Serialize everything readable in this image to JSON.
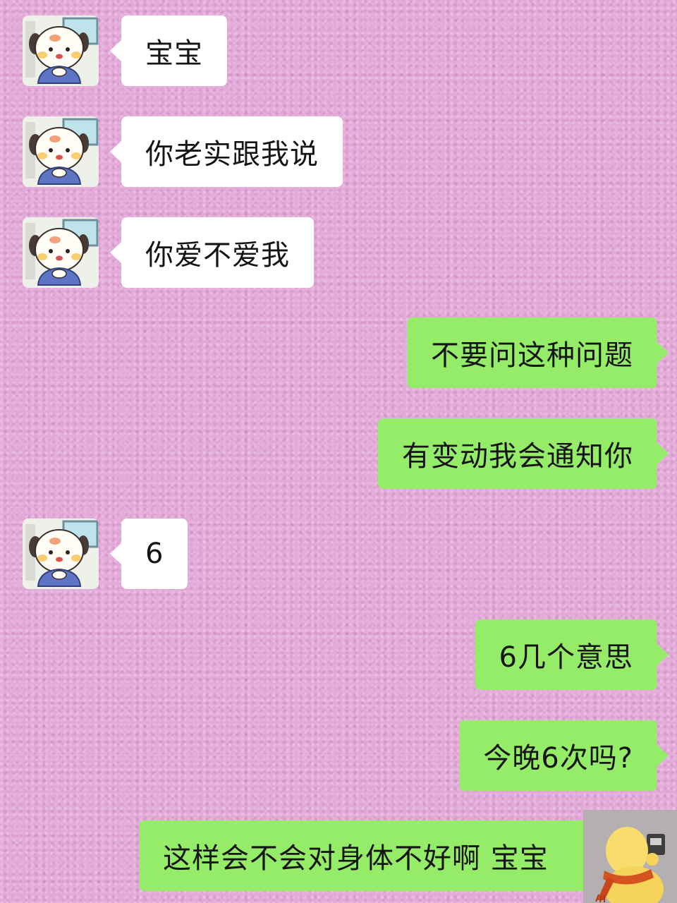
{
  "chat": {
    "contact_avatar_icon": "puppy-avatar-icon",
    "self_avatar_icon": "yellow-chick-avatar-icon",
    "messages": [
      {
        "side": "received",
        "text": "宝宝"
      },
      {
        "side": "received",
        "text": "你老实跟我说"
      },
      {
        "side": "received",
        "text": "你爱不爱我"
      },
      {
        "side": "sent",
        "text": "不要问这种问题"
      },
      {
        "side": "sent",
        "text": "有变动我会通知你"
      },
      {
        "side": "received",
        "text": "6"
      },
      {
        "side": "sent",
        "text": "6几个意思"
      },
      {
        "side": "sent",
        "text": "今晚6次吗?"
      },
      {
        "side": "sent",
        "text": "这样会不会对身体不好啊 宝宝"
      }
    ]
  },
  "colors": {
    "background": "#e3a9d8",
    "received_bubble": "#ffffff",
    "sent_bubble": "#95ec69"
  }
}
